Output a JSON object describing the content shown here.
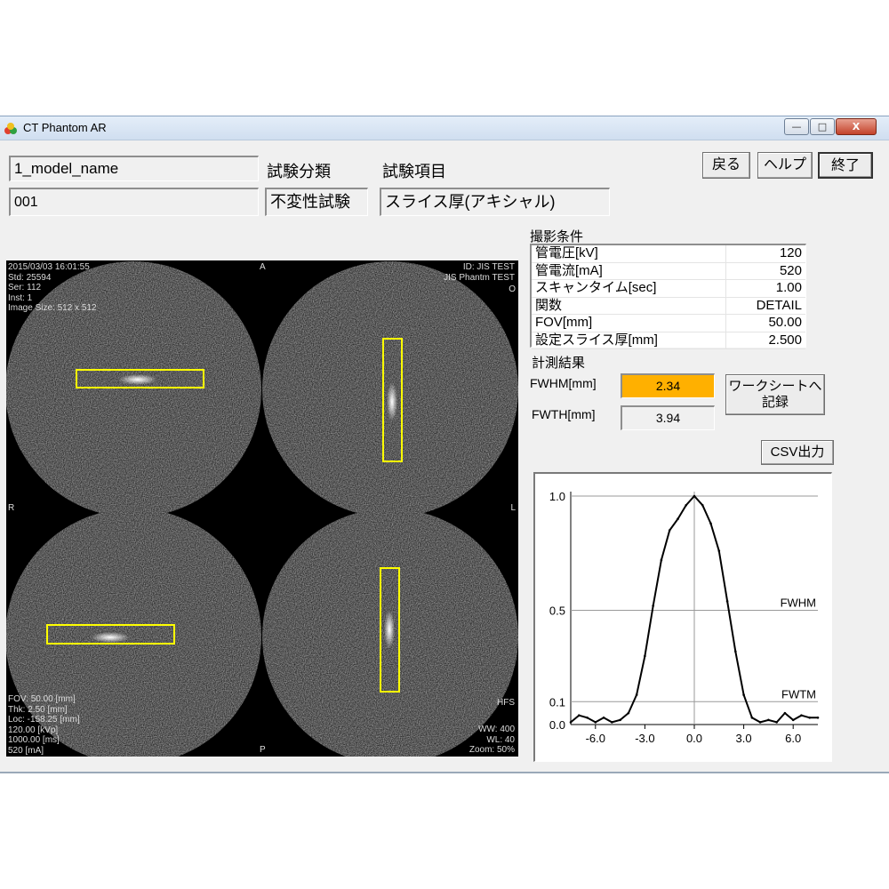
{
  "window": {
    "title": "CT Phantom AR",
    "controls": {
      "minimize": "—",
      "maximize": "□",
      "close": "X"
    }
  },
  "header": {
    "model_name": "1_model_name",
    "model_code": "001",
    "category_label": "試験分類",
    "category_value": "不変性試験",
    "item_label": "試験項目",
    "item_value": "スライス厚(アキシャル)",
    "back_button": "戻る",
    "help_button": "ヘルプ",
    "exit_button": "終了"
  },
  "viewer": {
    "top_left": [
      "2015/03/03 16:01:55",
      "",
      "Std: 25594",
      "Ser: 112",
      "Inst: 1",
      "Image Size: 512 x 512"
    ],
    "top_right": [
      "ID: JIS TEST",
      "JIS Phantm TEST"
    ],
    "bottom_left": [
      "FOV: 50.00 [mm]",
      "Thk: 2.50 [mm]",
      "Loc: -158.25 [mm]",
      "120.00 [kVp]",
      "1000.00 [ms]",
      "520 [mA]"
    ],
    "bottom_right": [
      "WW: 400",
      "WL: 40",
      "Zoom: 50%"
    ],
    "orient": {
      "top": "A",
      "bottom": "P",
      "left": "R",
      "right": "L",
      "hfs": "HFS",
      "o": "O"
    }
  },
  "conditions": {
    "title": "撮影条件",
    "rows": [
      {
        "label": "管電圧[kV]",
        "value": "120"
      },
      {
        "label": "管電流[mA]",
        "value": "520"
      },
      {
        "label": "スキャンタイム[sec]",
        "value": "1.00"
      },
      {
        "label": "関数",
        "value": "DETAIL"
      },
      {
        "label": "FOV[mm]",
        "value": "50.00"
      },
      {
        "label": "設定スライス厚[mm]",
        "value": "2.500"
      }
    ]
  },
  "results": {
    "title": "計測結果",
    "fwhm_label": "FWHM[mm]",
    "fwhm_value": "2.34",
    "fwth_label": "FWTH[mm]",
    "fwth_value": "3.94",
    "worksheet_button_line1": "ワークシートへ",
    "worksheet_button_line2": "記録",
    "csv_button": "CSV出力"
  },
  "colors": {
    "highlight": "#ffb000",
    "roi": "#ffff00",
    "window_bg": "#f0f0f0"
  },
  "chart_data": {
    "type": "line",
    "xlim": [
      -7.5,
      7.5
    ],
    "ylim": [
      0.0,
      1.0
    ],
    "x_ticks": [
      "-6.0",
      "-3.0",
      "0.0",
      "3.0",
      "6.0"
    ],
    "y_ticks": [
      "1.0",
      "0.5",
      "0.1",
      "0.0"
    ],
    "annotations": [
      "FWHM",
      "FWTM"
    ],
    "series": [
      {
        "x": [
          -7.5,
          -7.0,
          -6.5,
          -6.0,
          -5.5,
          -5.0,
          -4.5,
          -4.0,
          -3.5,
          -3.0,
          -2.5,
          -2.0,
          -1.5,
          -1.0,
          -0.5,
          0.0,
          0.5,
          1.0,
          1.5,
          2.0,
          2.5,
          3.0,
          3.5,
          4.0,
          4.5,
          5.0,
          5.5,
          6.0,
          6.5,
          7.0,
          7.5
        ],
        "y": [
          0.01,
          0.04,
          0.03,
          0.01,
          0.03,
          0.01,
          0.02,
          0.05,
          0.13,
          0.3,
          0.52,
          0.72,
          0.85,
          0.9,
          0.96,
          1.0,
          0.96,
          0.88,
          0.76,
          0.54,
          0.32,
          0.13,
          0.03,
          0.01,
          0.02,
          0.01,
          0.05,
          0.02,
          0.04,
          0.03,
          0.03
        ]
      }
    ]
  }
}
